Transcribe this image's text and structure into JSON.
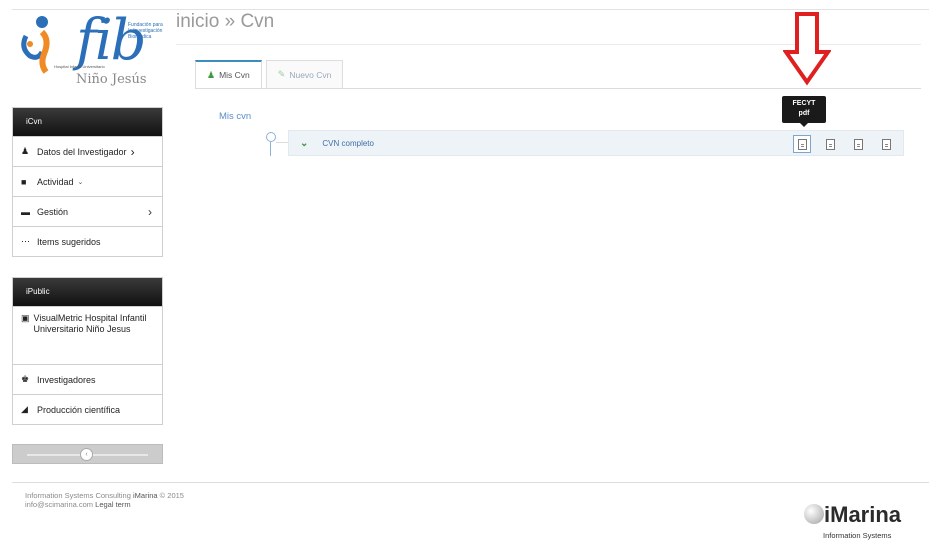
{
  "logo": {
    "mark": "fib",
    "small_text": "Fundación para la Investigación Biomédica",
    "sub_text": "Hospital Infantil Universitario",
    "name": "Niño Jesús"
  },
  "breadcrumb": {
    "root": "inicio",
    "separator": "»",
    "current": "Cvn"
  },
  "tabs": [
    {
      "label": "Mis Cvn",
      "active": true
    },
    {
      "label": "Nuevo Cvn",
      "active": false
    }
  ],
  "sidebar": {
    "icvn": {
      "title": "iCvn",
      "items": [
        {
          "label": "Datos del Investigador",
          "icon": "user-icon",
          "chevron": "›"
        },
        {
          "label": "Actividad",
          "icon": "book-icon",
          "chevron": "⌄"
        },
        {
          "label": "Gestión",
          "icon": "briefcase-icon",
          "chevron": "›"
        },
        {
          "label": "Items sugeridos",
          "icon": "dots-icon",
          "chevron": ""
        }
      ]
    },
    "ipublic": {
      "title": "iPublic",
      "items": [
        {
          "label": "VisualMetric Hospital Infantil Universitario Niño Jesus",
          "icon": "picture-icon"
        },
        {
          "label": "Investigadores",
          "icon": "users-icon"
        },
        {
          "label": "Producción científica",
          "icon": "signal-icon"
        }
      ]
    }
  },
  "content": {
    "section_title": "Mis cvn",
    "cvn_label": "CVN completo",
    "tooltip_line1": "FECYT",
    "tooltip_line2": "pdf"
  },
  "footer": {
    "company": "Information Systems Consulting",
    "brand_inline": "iMarina",
    "year": "© 2015",
    "email": "info@scimarina.com",
    "legal": "Legal term"
  },
  "brand": {
    "name": "iMarina",
    "sub": "Information Systems"
  },
  "colors": {
    "accent": "#3c8dbc",
    "link": "#3c6ea5",
    "annotation_arrow": "#e02020",
    "panel_header": "#1a1a1a"
  }
}
